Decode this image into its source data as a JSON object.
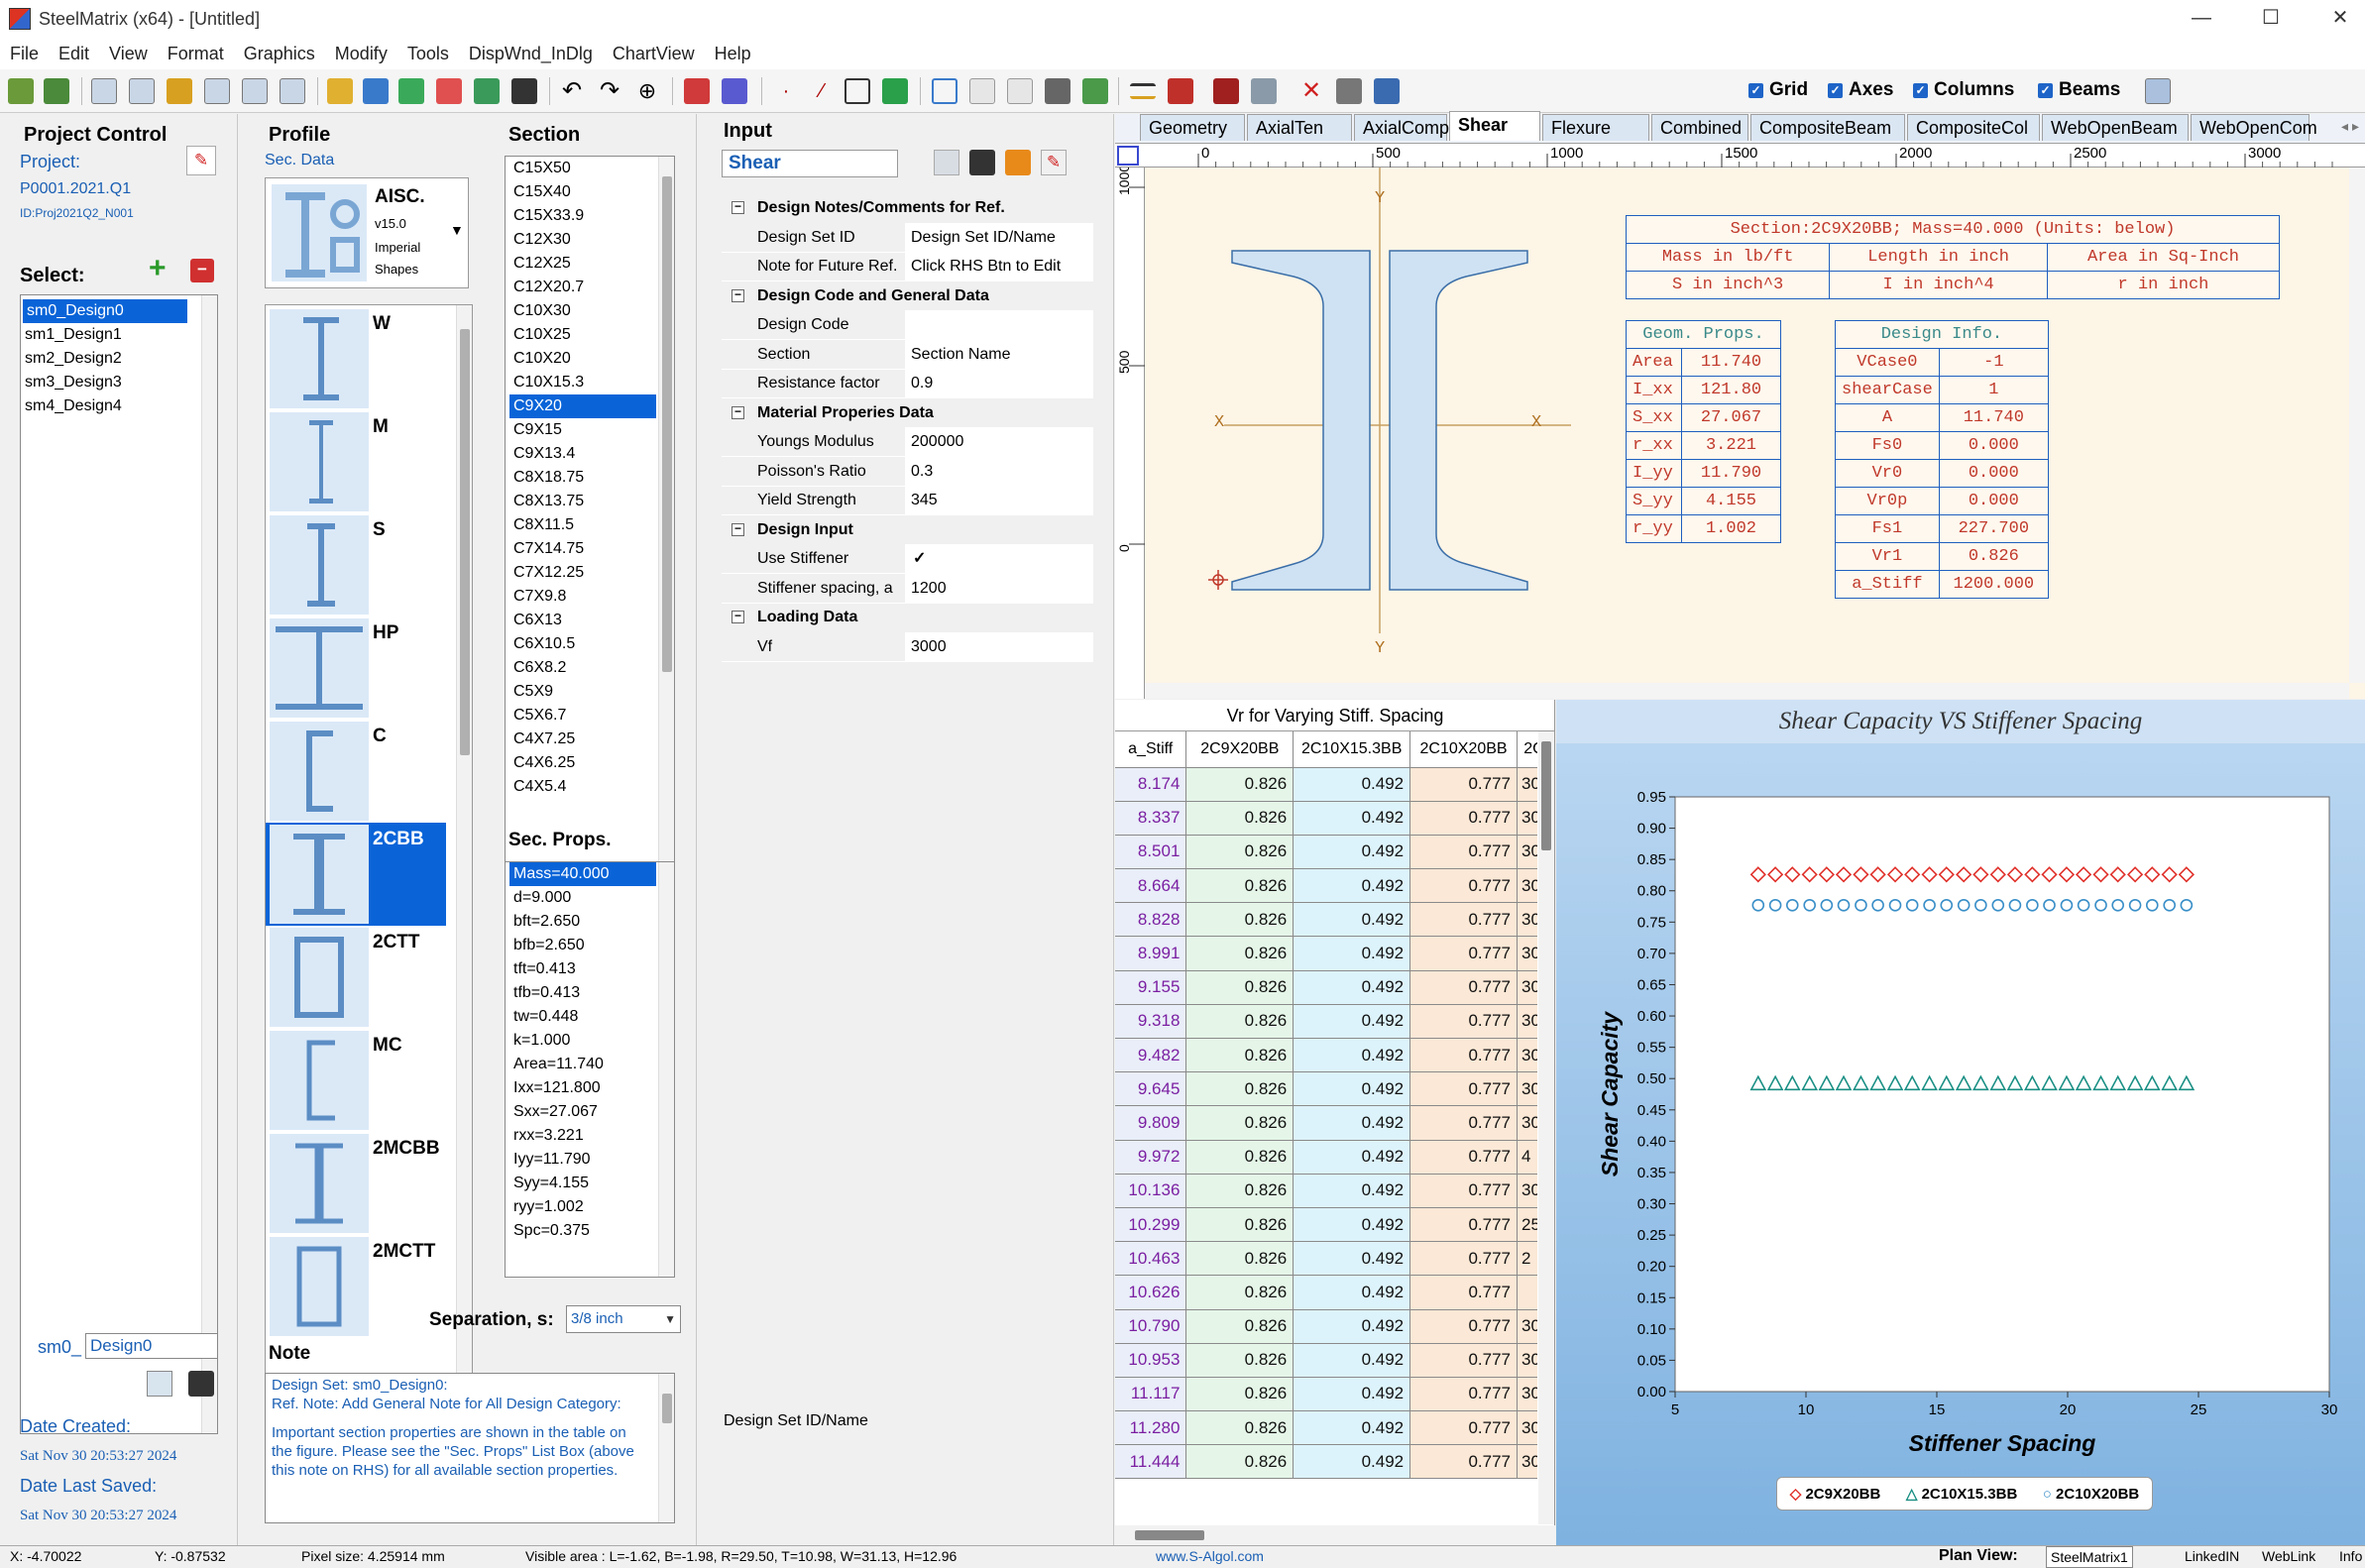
{
  "window": {
    "title": "SteelMatrix (x64) - [Untitled]"
  },
  "menu": [
    "File",
    "Edit",
    "View",
    "Format",
    "Graphics",
    "Modify",
    "Tools",
    "DispWnd_InDlg",
    "ChartView",
    "Help"
  ],
  "toolbar_toggles": [
    {
      "label": "Grid",
      "checked": true
    },
    {
      "label": "Axes",
      "checked": true
    },
    {
      "label": "Columns",
      "checked": true
    },
    {
      "label": "Beams",
      "checked": true
    }
  ],
  "project_control": {
    "title": "Project Control",
    "project_label": "Project:",
    "project_id": "P0001.2021.Q1",
    "project_sub": "ID:Proj2021Q2_N001",
    "select_label": "Select:",
    "designs": [
      "sm0_Design0",
      "sm1_Design1",
      "sm2_Design2",
      "sm3_Design3",
      "sm4_Design4"
    ],
    "selected_design": "sm0_Design0",
    "name_prefix": "sm0_",
    "name_value": "Design0",
    "date_created_label": "Date Created:",
    "date_created": "Sat Nov 30 20:53:27 2024",
    "date_saved_label": "Date Last Saved:",
    "date_saved": "Sat Nov 30 20:53:27 2024"
  },
  "profile": {
    "title": "Profile",
    "sec_data": "Sec. Data",
    "lib_name": "AISC.",
    "lib_ver": "v15.0",
    "lib_l1": "Imperial",
    "lib_l2": "Shapes",
    "shapes": [
      "W",
      "M",
      "S",
      "HP",
      "C",
      "2CBB",
      "2CTT",
      "MC",
      "2MCBB",
      "2MCTT"
    ],
    "selected_shape": "2CBB",
    "separation_label": "Separation, s:",
    "separation_value": "3/8 inch"
  },
  "section": {
    "title": "Section",
    "items": [
      "C15X50",
      "C15X40",
      "C15X33.9",
      "C12X30",
      "C12X25",
      "C12X20.7",
      "C10X30",
      "C10X25",
      "C10X20",
      "C10X15.3",
      "C9X20",
      "C9X15",
      "C9X13.4",
      "C8X18.75",
      "C8X13.75",
      "C8X11.5",
      "C7X14.75",
      "C7X12.25",
      "C7X9.8",
      "C6X13",
      "C6X10.5",
      "C6X8.2",
      "C5X9",
      "C5X6.7",
      "C4X7.25",
      "C4X6.25",
      "C4X5.4"
    ],
    "selected": "C9X20"
  },
  "sec_props": {
    "title": "Sec. Props.",
    "items": [
      "Mass=40.000",
      "d=9.000",
      "bft=2.650",
      "bfb=2.650",
      "tft=0.413",
      "tfb=0.413",
      "tw=0.448",
      "k=1.000",
      "Area=11.740",
      "Ixx=121.800",
      "Sxx=27.067",
      "rxx=3.221",
      "Iyy=11.790",
      "Syy=4.155",
      "ryy=1.002",
      "Spc=0.375"
    ]
  },
  "note": {
    "title": "Note",
    "line1": "Design Set: sm0_Design0:",
    "line2": "Ref. Note: Add General Note for All Design Category:",
    "body": "Important section properties are shown in the table on the figure. Please see the \"Sec. Props\" List Box (above this note on RHS) for all available section properties."
  },
  "input": {
    "title": "Input",
    "mode": "Shear",
    "footer": "Design Set ID/Name",
    "groups": [
      {
        "title": "Design Notes/Comments for Ref.",
        "rows": [
          [
            "Design Set ID",
            "Design Set ID/Name"
          ],
          [
            "Note for Future Ref.",
            "Click RHS Btn to Edit"
          ]
        ]
      },
      {
        "title": "Design Code and General Data",
        "rows": [
          [
            "Design Code",
            ""
          ],
          [
            "Section",
            "Section Name"
          ],
          [
            "Resistance factor",
            "0.9"
          ]
        ]
      },
      {
        "title": "Material Properies Data",
        "rows": [
          [
            "Youngs Modulus",
            "200000"
          ],
          [
            "Poisson's Ratio",
            "0.3"
          ],
          [
            "Yield Strength",
            "345"
          ]
        ]
      },
      {
        "title": "Design Input",
        "rows": [
          [
            "Use Stiffener",
            "✓"
          ],
          [
            "Stiffener spacing, a",
            "1200"
          ]
        ]
      },
      {
        "title": "Loading Data",
        "rows": [
          [
            "Vf",
            "3000"
          ]
        ]
      }
    ]
  },
  "tabs": [
    "Geometry",
    "AxialTen",
    "AxialComp",
    "Shear",
    "Flexure",
    "Combined",
    "CompositeBeam",
    "CompositeCol",
    "WebOpenBeam",
    "WebOpenCom"
  ],
  "active_tab": "Shear",
  "ruler_h": [
    "0",
    "500",
    "1000",
    "1500",
    "2000",
    "2500",
    "3000"
  ],
  "ruler_v": [
    "1000",
    "500",
    "0"
  ],
  "drawing": {
    "axis_labels": {
      "y_top": "Y",
      "y_bottom": "Y",
      "x_left": "X",
      "x_right": "X"
    },
    "header": "Section:2C9X20BB; Mass=40.000 (Units: below)",
    "units": [
      [
        "Mass in lb/ft",
        "Length in inch",
        "Area in Sq-Inch"
      ],
      [
        "S in inch^3",
        "I in inch^4",
        "r in inch"
      ]
    ],
    "geom_title": "Geom. Props.",
    "geom": [
      [
        "Area",
        "11.740"
      ],
      [
        "I_xx",
        "121.80"
      ],
      [
        "S_xx",
        "27.067"
      ],
      [
        "r_xx",
        "3.221"
      ],
      [
        "I_yy",
        "11.790"
      ],
      [
        "S_yy",
        "4.155"
      ],
      [
        "r_yy",
        "1.002"
      ]
    ],
    "design_title": "Design Info.",
    "design": [
      [
        "VCase0",
        "-1"
      ],
      [
        "shearCase",
        "1"
      ],
      [
        "A",
        "11.740"
      ],
      [
        "Fs0",
        "0.000"
      ],
      [
        "Vr0",
        "0.000"
      ],
      [
        "Vr0p",
        "0.000"
      ],
      [
        "Fs1",
        "227.700"
      ],
      [
        "Vr1",
        "0.826"
      ],
      [
        "a_Stiff",
        "1200.000"
      ]
    ]
  },
  "table": {
    "title": "Vr for Varying Stiff. Spacing",
    "headers": [
      "a_Stiff",
      "2C9X20BB",
      "2C10X15.3BB",
      "2C10X20BB",
      "2C"
    ],
    "rows": [
      [
        "8.174",
        "0.826",
        "0.492",
        "0.777",
        "30"
      ],
      [
        "8.337",
        "0.826",
        "0.492",
        "0.777",
        "30"
      ],
      [
        "8.501",
        "0.826",
        "0.492",
        "0.777",
        "30"
      ],
      [
        "8.664",
        "0.826",
        "0.492",
        "0.777",
        "30"
      ],
      [
        "8.828",
        "0.826",
        "0.492",
        "0.777",
        "30"
      ],
      [
        "8.991",
        "0.826",
        "0.492",
        "0.777",
        "30"
      ],
      [
        "9.155",
        "0.826",
        "0.492",
        "0.777",
        "30"
      ],
      [
        "9.318",
        "0.826",
        "0.492",
        "0.777",
        "30"
      ],
      [
        "9.482",
        "0.826",
        "0.492",
        "0.777",
        "30"
      ],
      [
        "9.645",
        "0.826",
        "0.492",
        "0.777",
        "30"
      ],
      [
        "9.809",
        "0.826",
        "0.492",
        "0.777",
        "30"
      ],
      [
        "9.972",
        "0.826",
        "0.492",
        "0.777",
        "4"
      ],
      [
        "10.136",
        "0.826",
        "0.492",
        "0.777",
        "30"
      ],
      [
        "10.299",
        "0.826",
        "0.492",
        "0.777",
        "25"
      ],
      [
        "10.463",
        "0.826",
        "0.492",
        "0.777",
        "2"
      ],
      [
        "10.626",
        "0.826",
        "0.492",
        "0.777",
        ""
      ],
      [
        "10.790",
        "0.826",
        "0.492",
        "0.777",
        "30"
      ],
      [
        "10.953",
        "0.826",
        "0.492",
        "0.777",
        "30"
      ],
      [
        "11.117",
        "0.826",
        "0.492",
        "0.777",
        "30"
      ],
      [
        "11.280",
        "0.826",
        "0.492",
        "0.777",
        "30"
      ],
      [
        "11.444",
        "0.826",
        "0.492",
        "0.777",
        "30"
      ]
    ]
  },
  "chart_data": {
    "type": "scatter",
    "title": "Shear Capacity VS Stiffener Spacing",
    "xlabel": "Stiffener Spacing",
    "ylabel": "Shear Capacity",
    "xlim": [
      5,
      30
    ],
    "ylim": [
      0,
      0.95
    ],
    "x_ticks": [
      "5",
      "10",
      "15",
      "20",
      "25",
      "30"
    ],
    "y_ticks": [
      "0.00",
      "0.05",
      "0.10",
      "0.15",
      "0.20",
      "0.25",
      "0.30",
      "0.35",
      "0.40",
      "0.45",
      "0.50",
      "0.55",
      "0.60",
      "0.65",
      "0.70",
      "0.75",
      "0.80",
      "0.85",
      "0.90",
      "0.95"
    ],
    "x": [
      8.174,
      8.83,
      9.48,
      10.14,
      10.79,
      11.44,
      12.1,
      12.75,
      13.41,
      14.06,
      14.72,
      15.37,
      16.03,
      16.68,
      17.34,
      17.99,
      18.65,
      19.3,
      19.96,
      20.61,
      21.27,
      21.92,
      22.58,
      23.23,
      23.89,
      24.54
    ],
    "series": [
      {
        "name": "2C9X20BB",
        "value": 0.826,
        "color": "#e0302a",
        "marker": "diamond"
      },
      {
        "name": "2C10X15.3BB",
        "value": 0.492,
        "color": "#1a8f84",
        "marker": "triangle"
      },
      {
        "name": "2C10X20BB",
        "value": 0.777,
        "color": "#3a8fc8",
        "marker": "circle"
      }
    ],
    "grid": false,
    "legend": "bottom"
  },
  "status": {
    "x": "X: -4.70022",
    "y": "Y: -0.87532",
    "pixel": "Pixel size: 4.25914 mm",
    "visible": "Visible area : L=-1.62, B=-1.98, R=29.50, T=10.98, W=31.13, H=12.96",
    "url": "www.S-Algol.com",
    "plan_label": "Plan View:",
    "plan_value": "SteelMatrix1",
    "linked": "LinkedIN",
    "weblink": "WebLink",
    "info": "Info"
  }
}
